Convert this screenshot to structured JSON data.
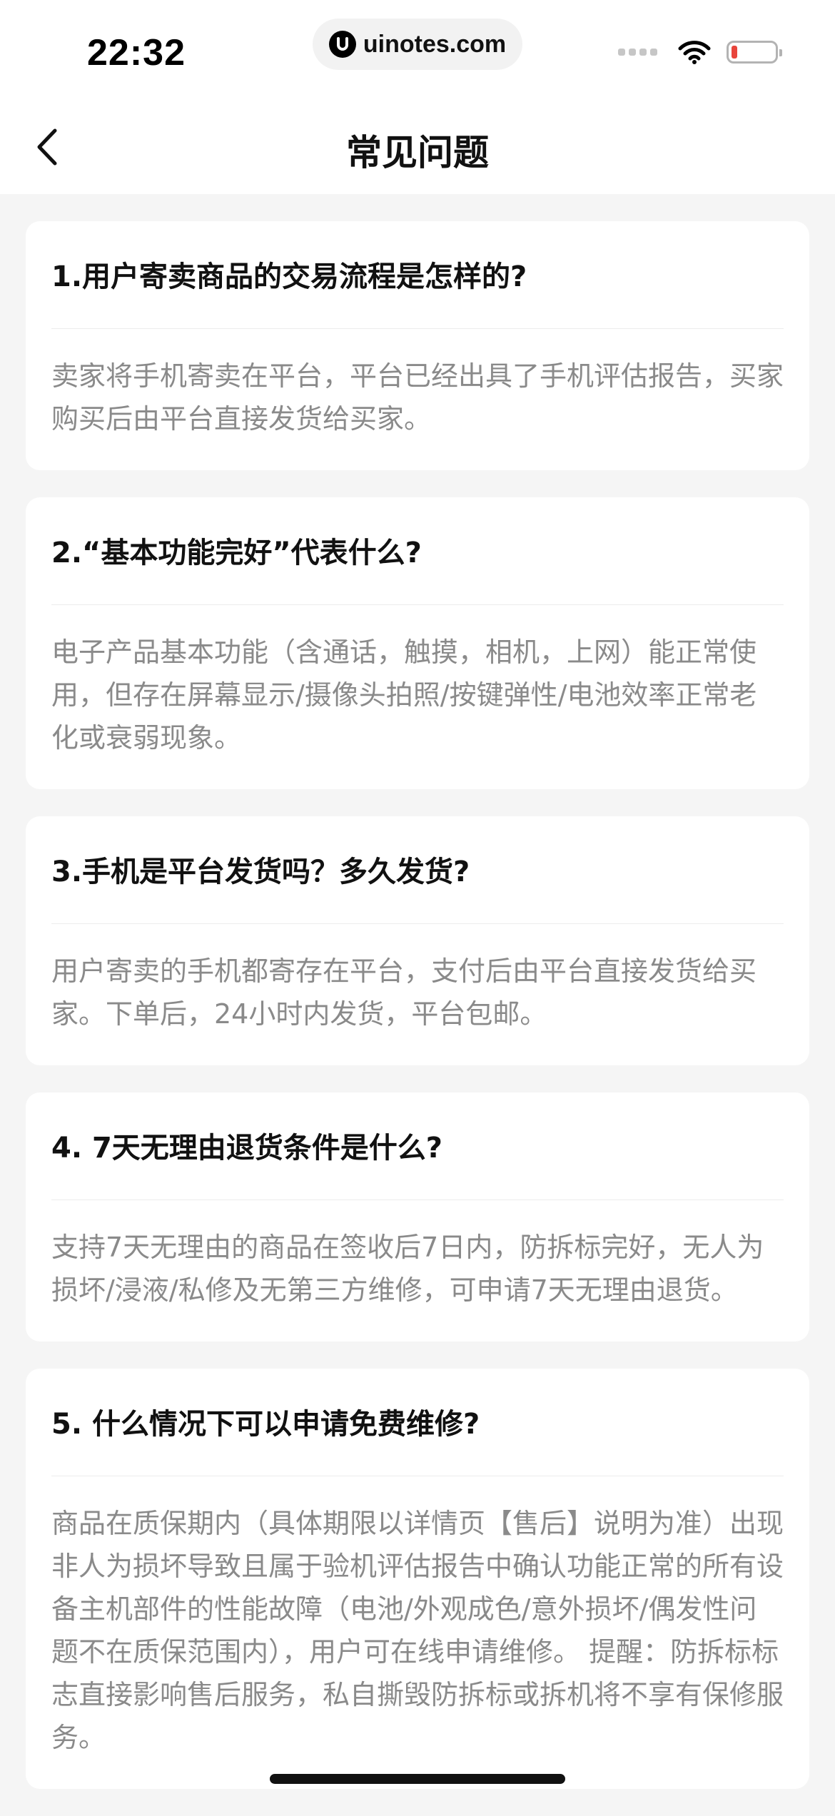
{
  "status_bar": {
    "time": "22:32",
    "url": "uinotes.com",
    "icons": [
      "signal-dots-icon",
      "wifi-icon",
      "battery-low-icon"
    ]
  },
  "nav": {
    "back_icon": "chevron-left-icon",
    "title": "常见问题"
  },
  "faq": [
    {
      "question": "1.用户寄卖商品的交易流程是怎样的?",
      "answer": "卖家将手机寄卖在平台，平台已经出具了手机评估报告，买家购买后由平台直接发货给买家。"
    },
    {
      "question": "2.“基本功能完好”代表什么?",
      "answer": "电子产品基本功能（含通话，触摸，相机，上网）能正常使用，但存在屏幕显示/摄像头拍照/按键弹性/电池效率正常老化或衰弱现象。"
    },
    {
      "question": "3.手机是平台发货吗？多久发货?",
      "answer": "用户寄卖的手机都寄存在平台，支付后由平台直接发货给买家。下单后，24小时内发货，平台包邮。"
    },
    {
      "question": "4. 7天无理由退货条件是什么?",
      "answer": "支持7天无理由的商品在签收后7日内，防拆标完好，无人为损坏/浸液/私修及无第三方维修，可申请7天无理由退货。"
    },
    {
      "question": "5. 什么情况下可以申请免费维修?",
      "answer": "商品在质保期内（具体期限以详情页【售后】说明为准）出现非人为损坏导致且属于验机评估报告中确认功能正常的所有设备主机部件的性能故障（电池/外观成色/意外损坏/偶发性问题不在质保范围内），用户可在线申请维修。 提醒：防拆标标志直接影响售后服务，私自撕毁防拆标或拆机将不享有保修服务。"
    }
  ],
  "colors": {
    "page_bg": "#f5f5f5",
    "card_bg": "#ffffff",
    "question_text": "#111111",
    "answer_text": "#8a8a8a",
    "battery_low": "#e8453c"
  }
}
